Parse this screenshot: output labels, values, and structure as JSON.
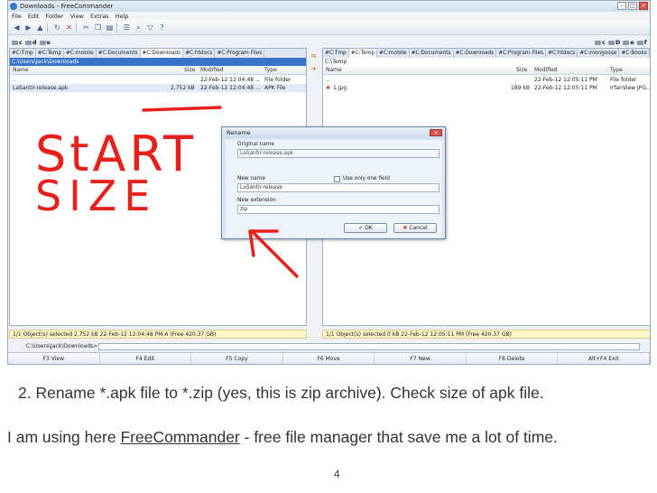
{
  "window": {
    "title": "Downloads - FreeCommander"
  },
  "menu": [
    "File",
    "Edit",
    "Folder",
    "View",
    "Extras",
    "Help"
  ],
  "toolbar_icons": [
    "back-icon",
    "forward-icon",
    "up-icon",
    "refresh-icon",
    "delete-icon",
    "cut-icon",
    "copy-icon",
    "paste-icon",
    "properties-icon",
    "search-icon",
    "filter-icon",
    "help-icon"
  ],
  "left": {
    "drives": [
      "c",
      "d",
      "e"
    ],
    "tabs": [
      "#C:Tmp",
      "#C:Temp",
      "#C:mobile",
      "#C:Documents",
      "#C:Downloads",
      "#C:htdocs",
      "#C:Program Files"
    ],
    "active_tab": 4,
    "path": "C:\\Users\\Jack\\Downloads",
    "columns": {
      "name": "Name",
      "size": "Size",
      "modified": "Modified",
      "type": "Type"
    },
    "rows": [
      {
        "name": "..",
        "size": "",
        "modified": "22-Feb-12 12:04:48 ...",
        "type": "File folder"
      },
      {
        "name": "LaSantir-release.apk",
        "size": "2,752 kB",
        "modified": "22-Feb-12 12:04:48 ...",
        "type": "APK File"
      }
    ],
    "status": "1/1 Object(s) selected  2,752 kB  22-Feb-12 12:04:48 PM  A  (Free 420.37 GB)"
  },
  "right": {
    "drives": [
      "c",
      "D",
      "e",
      "f"
    ],
    "tabs": [
      "#C:Tmp",
      "#C:Temp",
      "#C:mobile",
      "#C:Documents",
      "#C:Downloads",
      "#C:Program Files",
      "#C:htdocs",
      "#C:mongoose",
      "#C:Books"
    ],
    "active_tab": 1,
    "path": "C:\\Temp",
    "columns": {
      "name": "Name",
      "size": "Size",
      "modified": "Modified",
      "type": "Type"
    },
    "rows": [
      {
        "name": "..",
        "size": "",
        "modified": "22-Feb-12 12:05:11 PM",
        "type": "File folder"
      },
      {
        "name": "1.jpg",
        "size": "189 kB",
        "modified": "22-Feb-12 12:05:11 PM",
        "type": "IrfanView JPG..."
      }
    ],
    "status": "1/1 Object(s) selected  0 kB  22-Feb-12 12:05:11 PM  (Free 420.37 GB)"
  },
  "cmdline": {
    "label": "C:\\Users\\Jack\\Downloads>"
  },
  "fkeys": [
    "F3 View",
    "F4 Edit",
    "F5 Copy",
    "F6 Move",
    "F7 New",
    "F8 Delete",
    "Alt+F4 Exit"
  ],
  "dialog": {
    "title": "Rename",
    "original_label": "Original name",
    "original_value": "LaSantir-release.apk",
    "newname_label": "New name",
    "newname_value": "LaSantir-release",
    "checkbox_label": "Use only one field",
    "newext_label": "New extension",
    "newext_value": "zip",
    "ok": "OK",
    "cancel": "Cancel"
  },
  "annotation": {
    "line1": "StART",
    "line2": "SIZE",
    "color": "#e8201c"
  },
  "caption": {
    "line1": "2. Rename *.apk file to *.zip (yes, this is zip archive).  Check size of apk file.",
    "line2_before": "I am using here ",
    "line2_link": "FreeCommander",
    "line2_after": " - free file manager that save me a lot of time.",
    "page": "4"
  }
}
